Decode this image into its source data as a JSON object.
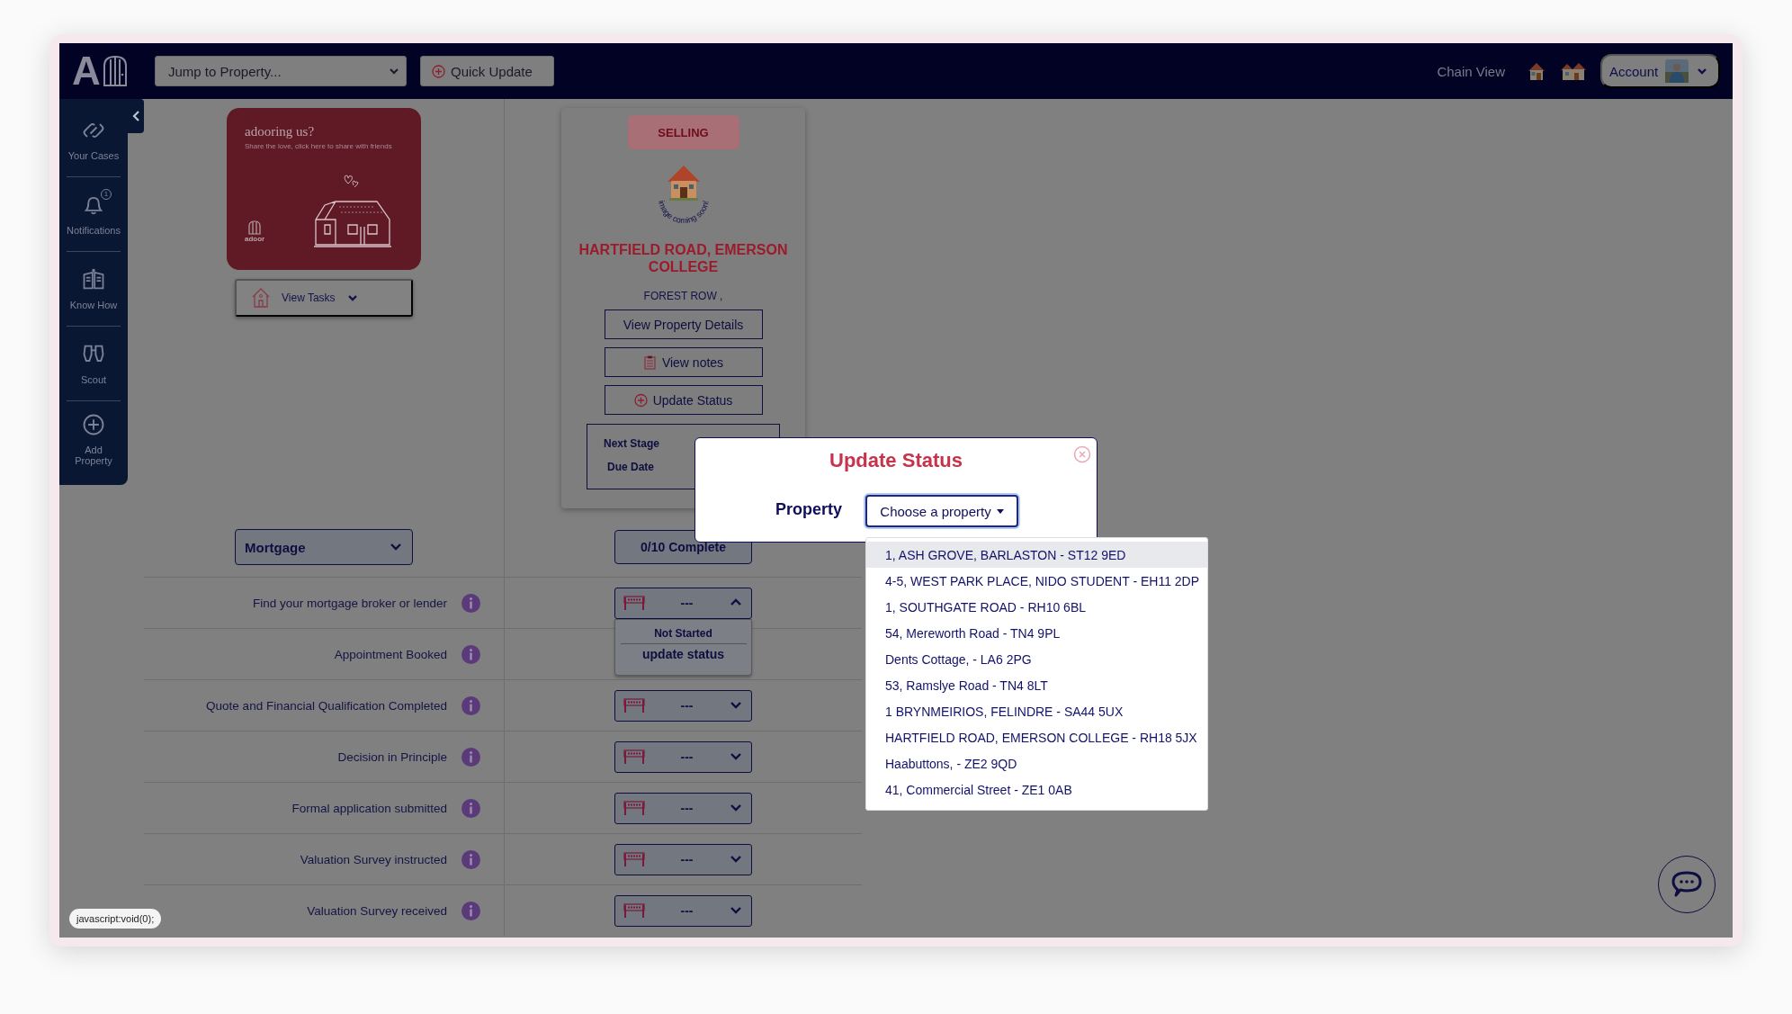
{
  "header": {
    "logo_letter": "A",
    "jump_to_property": "Jump to Property...",
    "quick_update": "Quick Update",
    "chain_view": "Chain View",
    "account": "Account"
  },
  "sidebar": {
    "items": [
      {
        "label": "Your Cases"
      },
      {
        "label": "Notifications",
        "badge": "1"
      },
      {
        "label": "Know How"
      },
      {
        "label": "Scout"
      },
      {
        "label": "Add Property"
      }
    ]
  },
  "promo": {
    "title": "adooring us?",
    "subtitle": "Share the love, click here to share with friends",
    "brand": "adoor",
    "view_tasks": "View Tasks"
  },
  "property_card": {
    "badge": "SELLING",
    "image_caption": "image coming soon!",
    "title": "HARTFIELD ROAD, EMERSON COLLEGE",
    "town": "FOREST ROW ,",
    "buttons": [
      "View Property Details",
      "View notes",
      "Update Status"
    ],
    "next_stage_label": "Next Stage",
    "due_date_label": "Due Date"
  },
  "category_select": "Mortgage",
  "progress": "0/10 Complete",
  "tasks": [
    {
      "label": "Find your mortgage broker or lender",
      "status": "---",
      "expanded": true,
      "menu": [
        "Not Started",
        "update status"
      ]
    },
    {
      "label": "Appointment Booked"
    },
    {
      "label": "Quote and Financial Qualification Completed",
      "status": "---",
      "expanded": false
    },
    {
      "label": "Decision in Principle",
      "status": "---",
      "expanded": false
    },
    {
      "label": "Formal application submitted",
      "status": "---",
      "expanded": false
    },
    {
      "label": "Valuation Survey instructed",
      "status": "---",
      "expanded": false
    },
    {
      "label": "Valuation Survey received",
      "status": "---",
      "expanded": false
    }
  ],
  "modal": {
    "title": "Update Status",
    "field_label": "Property",
    "dropdown": "Choose a property",
    "options": [
      {
        "label": "1, ASH GROVE, BARLASTON - ST12 9ED",
        "selected": true
      },
      {
        "label": "4-5, WEST PARK PLACE, NIDO STUDENT - EH11 2DP",
        "selected": false
      },
      {
        "label": "1, SOUTHGATE ROAD - RH10 6BL",
        "selected": false
      },
      {
        "label": "54, Mereworth Road - TN4 9PL",
        "selected": false
      },
      {
        "label": "Dents Cottage, - LA6 2PG",
        "selected": false
      },
      {
        "label": "53, Ramslye Road - TN4 8LT",
        "selected": false
      },
      {
        "label": "1 BRYNMEIRIOS, FELINDRE - SA44 5UX",
        "selected": false
      },
      {
        "label": "HARTFIELD ROAD, EMERSON COLLEGE - RH18 5JX",
        "selected": false
      },
      {
        "label": "Haabuttons, - ZE2 9QD",
        "selected": false
      },
      {
        "label": "41, Commercial Street - ZE1 0AB",
        "selected": false
      }
    ]
  },
  "tooltip": "javascript:void(0);"
}
